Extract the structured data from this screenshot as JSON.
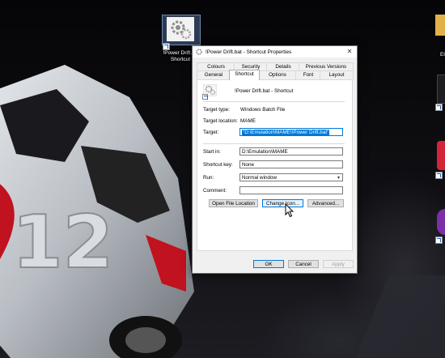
{
  "desktop": {
    "selected_icon_label": "!Power Drift.bat - Shortcut",
    "selected_icon_label_lines": [
      "!Power Drift.ba",
      "Shortcut"
    ],
    "edge_label": "El"
  },
  "dialog": {
    "title": "!Power Drift.bat - Shortcut Properties",
    "tabs_row1": [
      "Colours",
      "Security",
      "Details",
      "Previous Versions"
    ],
    "tabs_row2": [
      "General",
      "Shortcut",
      "Options",
      "Font",
      "Layout"
    ],
    "active_tab": "Shortcut",
    "shortcut_name": "!Power Drift.bat - Shortcut",
    "target_type_label": "Target type:",
    "target_type_value": "Windows Batch File",
    "target_location_label": "Target location:",
    "target_location_value": "MAME",
    "target_label": "Target:",
    "target_value": "\"D:\\Emulation\\MAME\\!Power Drift.bat\"",
    "start_in_label": "Start in:",
    "start_in_value": "D:\\Emulation\\MAME",
    "shortcut_key_label": "Shortcut key:",
    "shortcut_key_value": "None",
    "run_label": "Run:",
    "run_value": "Normal window",
    "comment_label": "Comment:",
    "comment_value": "",
    "open_file_location": "Open File Location",
    "change_icon": "Change Icon...",
    "advanced": "Advanced...",
    "ok": "OK",
    "cancel": "Cancel",
    "apply": "Apply",
    "close_glyph": "✕"
  },
  "colors": {
    "accent": "#0078d7",
    "dialog_bg": "#f0f0f0"
  }
}
